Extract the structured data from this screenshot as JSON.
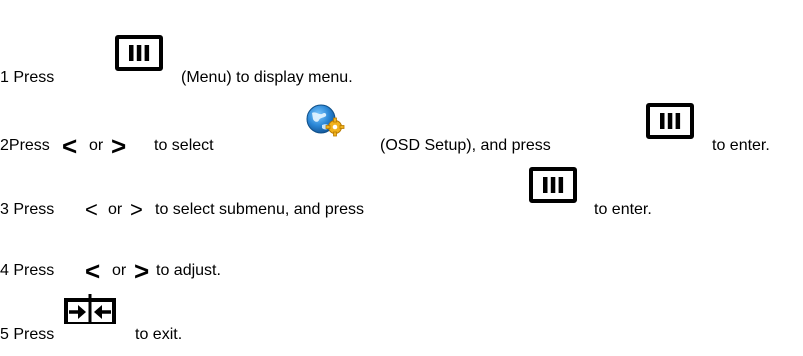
{
  "steps": [
    {
      "number": "1 Press",
      "icon": "menu-button-icon",
      "text": "(Menu) to display menu."
    },
    {
      "number": "2Press",
      "left": "<",
      "or": "or",
      "right": ">",
      "middle": "to select",
      "setup_icon": "osd-setup-icon",
      "setup_text": "(OSD Setup), and press",
      "icon": "menu-button-icon",
      "end": "to enter."
    },
    {
      "number": "3 Press",
      "left": "<",
      "or": "or",
      "right": ">",
      "text": "to select submenu, and press",
      "icon": "menu-button-icon",
      "end": "to enter."
    },
    {
      "number": "4 Press",
      "left": "<",
      "or": "or",
      "right": ">",
      "text": "to adjust."
    },
    {
      "number": "5 Press",
      "icon": "exit-button-icon",
      "end": "to exit."
    }
  ]
}
